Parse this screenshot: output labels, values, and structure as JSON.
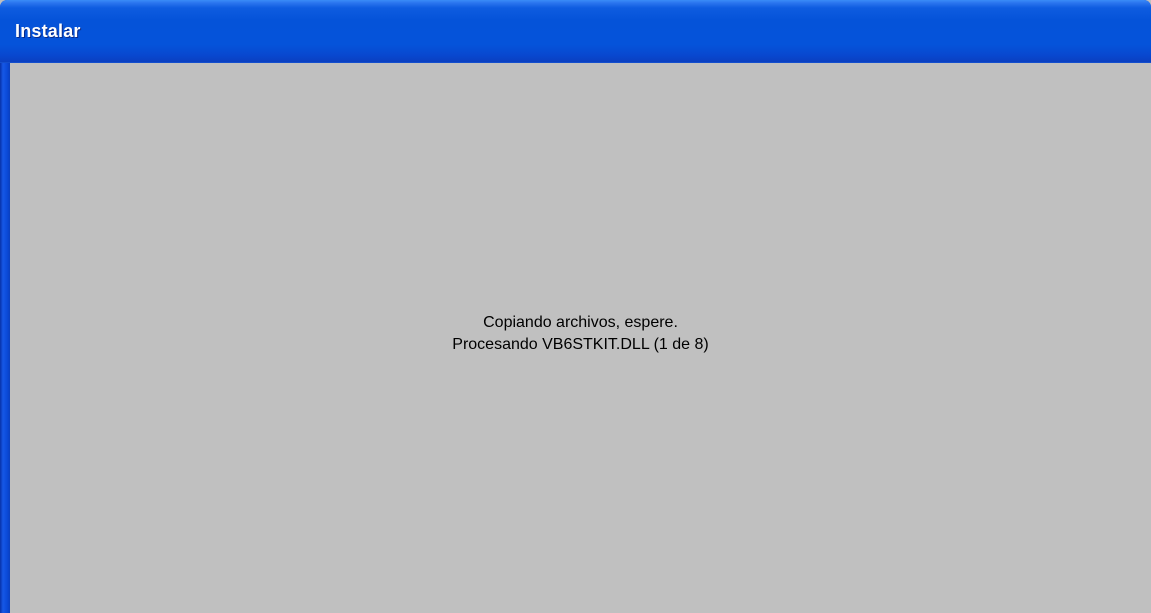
{
  "window": {
    "title": "Instalar"
  },
  "status": {
    "line1": "Copiando archivos, espere.",
    "line2": "Procesando VB6STKIT.DLL (1 de 8)"
  },
  "colors": {
    "titlebar": "#0553d9",
    "client_background": "#c0c0c0",
    "title_text": "#ffffff"
  }
}
